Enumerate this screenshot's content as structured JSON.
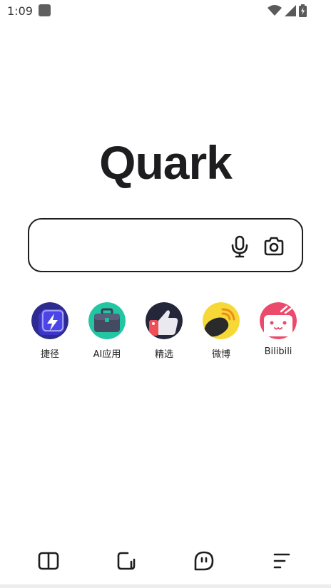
{
  "status_bar": {
    "time": "1:09",
    "icons": [
      "notification-icon",
      "wifi-icon",
      "signal-icon",
      "battery-icon"
    ]
  },
  "logo": {
    "text": "Quark"
  },
  "search": {
    "value": "",
    "placeholder": "",
    "mic_icon": "mic-icon",
    "camera_icon": "camera-icon"
  },
  "shortcuts": [
    {
      "label": "捷径",
      "icon": "lightning-icon",
      "color": "#4a3fd8"
    },
    {
      "label": "AI应用",
      "icon": "briefcase-icon",
      "color": "#1fbf9c"
    },
    {
      "label": "精选",
      "icon": "thumbs-up-icon",
      "color": "#262a40"
    },
    {
      "label": "微博",
      "icon": "weibo-icon",
      "color": "#f5d531"
    },
    {
      "label": "Bilibili",
      "icon": "bilibili-tv-icon",
      "color": "#ec4a6c"
    }
  ],
  "bottom_nav": {
    "items": [
      "book-icon",
      "tabs-icon",
      "chat-face-icon",
      "menu-icon"
    ]
  },
  "colors": {
    "text": "#1d1d1f",
    "background": "#ffffff"
  }
}
